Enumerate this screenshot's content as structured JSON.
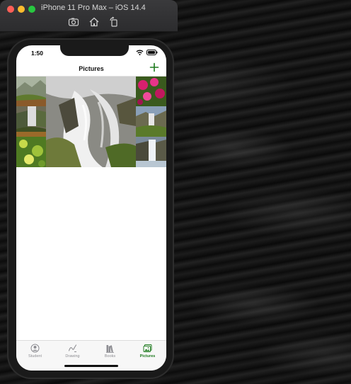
{
  "simulator": {
    "title": "iPhone 11 Pro Max – iOS 14.4",
    "icons": [
      "screenshot-icon",
      "home-icon",
      "rotate-icon"
    ]
  },
  "status_bar": {
    "time": "1:50"
  },
  "nav": {
    "title": "Pictures",
    "add_icon": "plus-icon"
  },
  "gallery": {
    "photos": [
      "mountain-meadow",
      "waterfall-river",
      "forest-flowers",
      "waterfall-closeup-large",
      "pink-flowers",
      "waterfall-valley",
      "waterfall-mist"
    ]
  },
  "tabs": [
    {
      "label": "Student",
      "icon": "person-circle-icon",
      "active": false
    },
    {
      "label": "Drawing",
      "icon": "scribble-icon",
      "active": false
    },
    {
      "label": "Books",
      "icon": "books-icon",
      "active": false
    },
    {
      "label": "Pictures",
      "icon": "photos-icon",
      "active": true
    }
  ],
  "colors": {
    "accent": "#1e7a1e",
    "inactive": "#8e8e93"
  }
}
